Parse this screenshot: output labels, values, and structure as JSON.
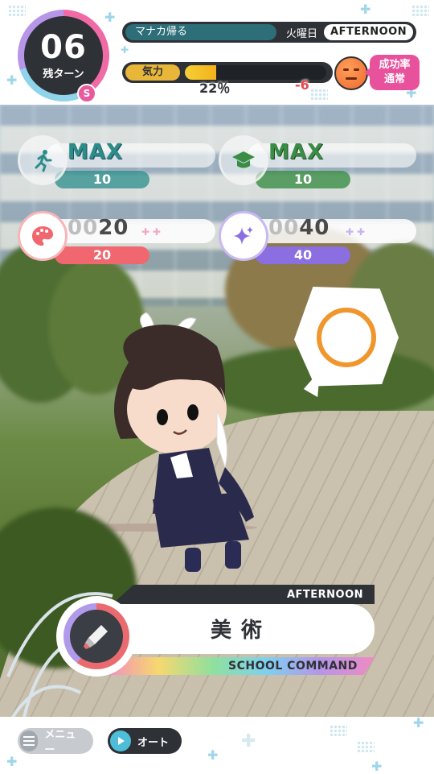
{
  "header": {
    "turns_remaining": "06",
    "turns_label": "残ターン",
    "rank_badge": "S",
    "event_name": "マナカ帰る",
    "weekday": "火曜日",
    "time_of_day": "AFTERNOON",
    "energy_label": "気力",
    "energy_percent_text": "22％",
    "energy_percent_value": 22,
    "energy_delta": "-6",
    "success_rate_line1": "成功率",
    "success_rate_line2": "通常"
  },
  "stats": {
    "athletic": {
      "value": "MAX",
      "sub": "10",
      "icon": "running-person-icon",
      "color": "#2b8c8a"
    },
    "study": {
      "value": "MAX",
      "sub": "10",
      "icon": "graduation-cap-icon",
      "color": "#3b8d46"
    },
    "art": {
      "value_dim": "00",
      "value": "20",
      "sub": "20",
      "icon": "palette-icon",
      "color": "#f0676f"
    },
    "charm": {
      "value_dim": "00",
      "value": "40",
      "sub": "40",
      "icon": "sparkle-icon",
      "color": "#8b6fe0"
    }
  },
  "speech_bubble": {
    "symbol": "circle-mark"
  },
  "command": {
    "time_tab": "AFTERNOON",
    "label": "美術",
    "footer": "SCHOOL COMMAND",
    "icon": "paint-tube-icon"
  },
  "bottom": {
    "menu_label": "メニュー",
    "auto_label": "オート"
  },
  "colors": {
    "dark": "#2e3136",
    "energy": "#f4b21b",
    "pink": "#e8529d",
    "orange_mark": "#f0962d"
  }
}
